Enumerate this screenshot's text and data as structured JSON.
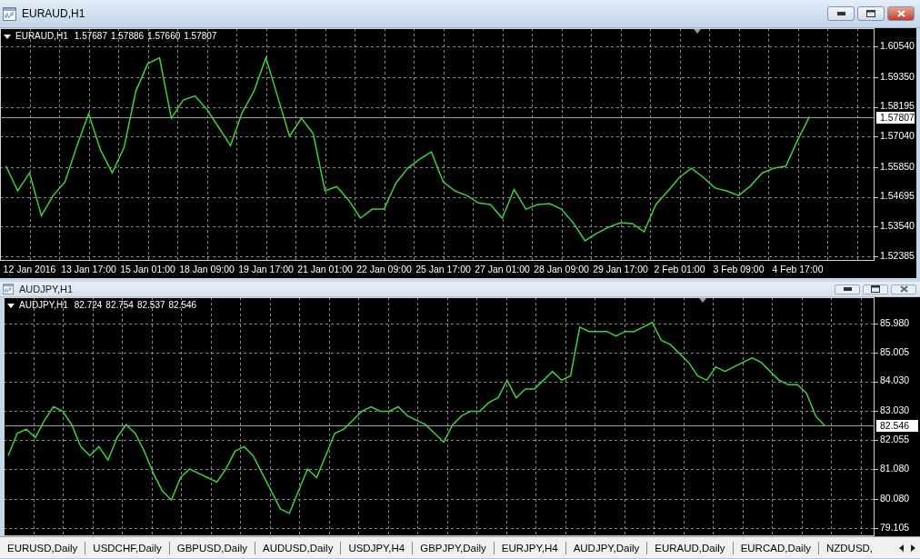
{
  "windows": [
    {
      "title": "EURAUD,H1",
      "active": true,
      "chart": {
        "header": {
          "symbol": "EURAUD,H1",
          "quotes": [
            "1.57687",
            "1.57886",
            "1.57660",
            "1.57807"
          ]
        },
        "chart_data": {
          "type": "line",
          "categories": [
            null,
            null,
            "12 Jan 2016",
            null,
            null,
            null,
            null,
            "13 Jan 17:00",
            null,
            null,
            null,
            null,
            "15 Jan 01:00",
            null,
            null,
            null,
            null,
            "18 Jan 09:00",
            null,
            null,
            null,
            null,
            "19 Jan 17:00",
            null,
            null,
            null,
            null,
            "21 Jan 01:00",
            null,
            null,
            null,
            null,
            "22 Jan 09:00",
            null,
            null,
            null,
            null,
            "25 Jan 17:00",
            null,
            null,
            null,
            null,
            "27 Jan 01:00",
            null,
            null,
            null,
            null,
            "28 Jan 09:00",
            null,
            null,
            null,
            null,
            "29 Jan 17:00",
            null,
            null,
            null,
            null,
            "2 Feb 01:00",
            null,
            null,
            null,
            null,
            "3 Feb 09:00",
            null,
            null,
            null,
            null,
            "4 Feb 17:00",
            null,
            null,
            null,
            null,
            null,
            null
          ],
          "series": [
            {
              "color": "#3ad33a",
              "values": [
                1.559,
                1.5493,
                1.5563,
                1.5396,
                1.5475,
                1.5528,
                1.5666,
                1.5793,
                1.5652,
                1.5563,
                1.5662,
                1.5881,
                1.5987,
                1.601,
                1.5775,
                1.5846,
                1.5862,
                1.581,
                1.574,
                1.5669,
                1.5798,
                1.5881,
                1.601,
                1.5858,
                1.5705,
                1.5775,
                1.5715,
                1.5493,
                1.551,
                1.5457,
                1.5387,
                1.5422,
                1.5422,
                1.5523,
                1.5581,
                1.5616,
                1.5644,
                1.5528,
                1.5493,
                1.5475,
                1.5446,
                1.544,
                1.5387,
                1.5499,
                1.5422,
                1.544,
                1.5443,
                1.5422,
                1.5369,
                1.5299,
                1.5328,
                1.5352,
                1.5369,
                1.5366,
                1.5334,
                1.544,
                1.5491,
                1.5546,
                1.5581,
                1.5546,
                1.5504,
                1.5493,
                1.5475,
                1.5512,
                1.5563,
                1.5581,
                1.5589,
                1.5691,
                1.5781,
                null,
                null,
                null,
                null,
                null
              ]
            }
          ],
          "ylim": [
            1.5221,
            1.6125
          ],
          "yticks": [
            {
              "value": 1.6054,
              "label": "1.60540"
            },
            {
              "value": 1.5935,
              "label": "1.59350"
            },
            {
              "value": 1.58195,
              "label": "1.58195"
            },
            {
              "value": 1.5704,
              "label": "1.57040"
            },
            {
              "value": 1.5585,
              "label": "1.55850"
            },
            {
              "value": 1.54695,
              "label": "1.54695"
            },
            {
              "value": 1.5354,
              "label": "1.53540"
            },
            {
              "value": 1.52385,
              "label": "1.52385"
            }
          ],
          "grid": true,
          "ref_lines": [
            {
              "axis": "y",
              "value": 1.57807,
              "label": "1.57807"
            }
          ]
        }
      }
    },
    {
      "title": "AUDJPY,H1",
      "active": false,
      "chart": {
        "header": {
          "symbol": "AUDJPY,H1",
          "quotes": [
            "82.724",
            "82.754",
            "82.537",
            "82.546"
          ]
        },
        "chart_data": {
          "type": "line",
          "categories": [
            null,
            null,
            null,
            null,
            null,
            null,
            null,
            null,
            null,
            null,
            null,
            null,
            null,
            null,
            null,
            null,
            null,
            null,
            null,
            null,
            null,
            null,
            null,
            null,
            null,
            null,
            null,
            null,
            null,
            null,
            null,
            null,
            null,
            null,
            null,
            null,
            null,
            null,
            null,
            null,
            null,
            null,
            null,
            null,
            null,
            null,
            null,
            null,
            null,
            null,
            null,
            null,
            null,
            null,
            null,
            null,
            null,
            null,
            null,
            null,
            null,
            null,
            null,
            null,
            null,
            null,
            null,
            null,
            null,
            null,
            null,
            null,
            null,
            null,
            null,
            null,
            null,
            null,
            null,
            null,
            null,
            null,
            null,
            null,
            null,
            null,
            null,
            null,
            null,
            null,
            null,
            null,
            null,
            null,
            null,
            null
          ],
          "series": [
            {
              "color": "#3ad33a",
              "values": [
                81.54,
                82.29,
                82.43,
                82.14,
                82.73,
                83.18,
                83.03,
                82.58,
                81.84,
                81.54,
                81.84,
                81.39,
                82.14,
                82.58,
                82.29,
                81.69,
                80.94,
                80.35,
                80.05,
                80.8,
                81.09,
                80.94,
                80.8,
                80.65,
                81.09,
                81.69,
                81.84,
                81.54,
                80.94,
                80.35,
                79.75,
                79.6,
                80.35,
                81.09,
                80.8,
                81.54,
                82.29,
                82.43,
                82.73,
                83.03,
                83.18,
                83.03,
                83.03,
                83.18,
                82.88,
                82.73,
                82.58,
                82.29,
                81.99,
                82.58,
                82.88,
                83.03,
                83.03,
                83.33,
                83.48,
                84.07,
                83.48,
                83.78,
                83.78,
                84.07,
                84.37,
                84.07,
                84.22,
                85.86,
                85.71,
                85.71,
                85.71,
                85.56,
                85.71,
                85.71,
                85.86,
                86.01,
                85.41,
                85.27,
                84.97,
                84.67,
                84.22,
                84.07,
                84.52,
                84.37,
                84.52,
                84.67,
                84.82,
                84.67,
                84.37,
                84.07,
                83.92,
                83.92,
                83.63,
                82.88,
                82.55,
                null,
                null,
                null,
                null,
                null
              ]
            }
          ],
          "ylim": [
            78.83,
            86.86
          ],
          "yticks": [
            {
              "value": 85.98,
              "label": "85.980"
            },
            {
              "value": 85.005,
              "label": "85.005"
            },
            {
              "value": 84.03,
              "label": "84.030"
            },
            {
              "value": 83.03,
              "label": "83.030"
            },
            {
              "value": 82.055,
              "label": "82.055"
            },
            {
              "value": 81.08,
              "label": "81.080"
            },
            {
              "value": 80.08,
              "label": "80.080"
            },
            {
              "value": 79.105,
              "label": "79.105"
            }
          ],
          "grid": true,
          "ref_lines": [
            {
              "axis": "y",
              "value": 82.546,
              "label": "82.546"
            }
          ]
        }
      }
    }
  ],
  "tabs": [
    {
      "label": "EURUSD,Daily"
    },
    {
      "label": "USDCHF,Daily"
    },
    {
      "label": "GBPUSD,Daily"
    },
    {
      "label": "AUDUSD,Daily"
    },
    {
      "label": "USDJPY,H4"
    },
    {
      "label": "GBPJPY,Daily"
    },
    {
      "label": "EURJPY,H4"
    },
    {
      "label": "AUDJPY,Daily"
    },
    {
      "label": "EURAUD,Daily"
    },
    {
      "label": "EURCAD,Daily"
    },
    {
      "label": "NZDUSD,"
    }
  ]
}
